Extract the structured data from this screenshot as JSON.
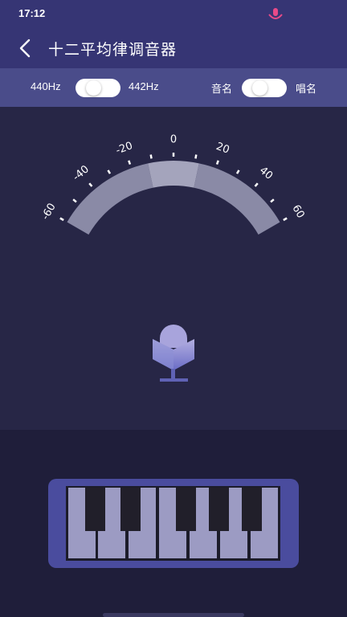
{
  "status_bar": {
    "time": "17:12",
    "icon": "microphone-status-icon"
  },
  "header": {
    "title": "十二平均律调音器",
    "back_icon": "chevron-left-icon"
  },
  "options": {
    "freq_left": "440Hz",
    "freq_right": "442Hz",
    "name_left": "音名",
    "name_right": "唱名"
  },
  "meter": {
    "ticks": [
      "-60",
      "-40",
      "-20",
      "0",
      "20",
      "40",
      "60"
    ],
    "icon": "microphone-icon"
  },
  "piano": {
    "white_keys": 7,
    "icon": "piano-keyboard"
  },
  "colors": {
    "header_bg": "#363574",
    "options_bg": "#4a4c8a",
    "meter_bg": "#272646",
    "arc": "#8a8aa6",
    "arc_center": "#a4a4bc",
    "piano_frame": "#4a4c9e",
    "white_key": "#9c9bc3"
  }
}
